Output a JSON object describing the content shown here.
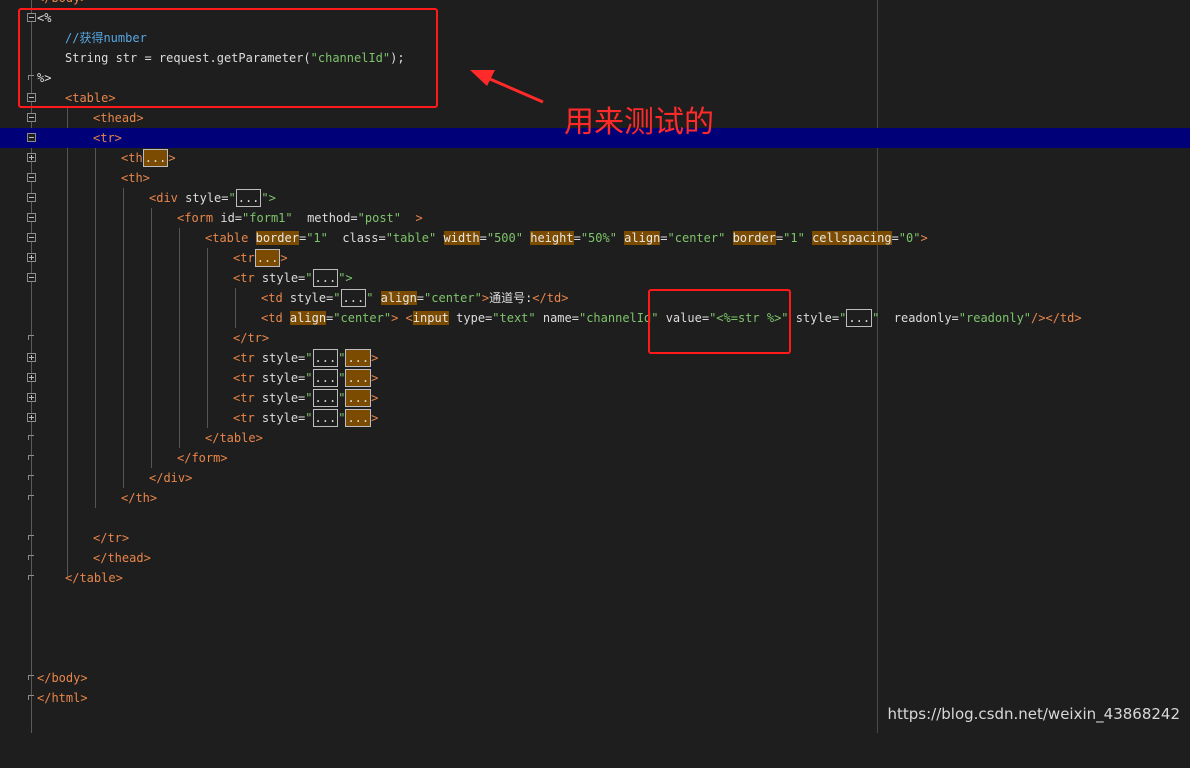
{
  "colors": {
    "background": "#1e1e1e",
    "tag": "#e8864a",
    "attribute_value": "#7ec46b",
    "comment": "#57a6e0",
    "highlight_line": "#000078",
    "annotation": "#ff2a2a"
  },
  "code": {
    "l_body_top": "</body>",
    "jsp_open": "<%",
    "comment": "//获得number",
    "java_stmt_a": "String str = request.getParameter(",
    "java_stmt_b": "\"channelId\"",
    "java_stmt_c": ");",
    "jsp_close": "%>",
    "table_open": "<table>",
    "thead_open": "<thead>",
    "tr_open": "<tr>",
    "th_collapsed_tag": "<th",
    "ellipsis": "...",
    "gt": ">",
    "th_open": "<th>",
    "div_a": "<div",
    "attr_style": "style=",
    "quote": "\"",
    "close_quote_gt": "\">",
    "form_tag": "<form",
    "attr_id": "id=",
    "val_form1": "\"form1\"",
    "attr_method": "method=",
    "val_post": "\"post\"",
    "inner_table": "<table",
    "attr_border": "border",
    "eq": "=",
    "val_1": "\"1\"",
    "attr_class": "class=",
    "val_table": "\"table\"",
    "attr_width": "width",
    "val_500": "\"500\"",
    "attr_height": "height",
    "val_50": "\"50%\"",
    "attr_align": "align",
    "val_center": "\"center\"",
    "attr_cellspacing": "cellspacing",
    "val_0": "\"0\"",
    "tr_collapsed": "<tr",
    "tr_style": "<tr",
    "td_tag": "<td",
    "label_text": "通道号:",
    "td_close": "</td>",
    "input_tag": "input",
    "lt": "<",
    "attr_type": "type=",
    "val_text": "\"text\"",
    "attr_name": "name=",
    "val_channelId": "\"channelId\"",
    "attr_value": "value=",
    "val_expr": "\"<%=str %>\"",
    "attr_readonly": "readonly=",
    "val_readonly": "\"readonly\"",
    "self_close_td": "/></td>",
    "tr_close": "</tr>",
    "table_close": "</table>",
    "form_close": "</form>",
    "div_close": "</div>",
    "th_close": "</th>",
    "thead_close": "</thead>",
    "body_close": "</body>",
    "html_close": "</html>"
  },
  "annotation": {
    "text": "用来测试的"
  },
  "watermark": "https://blog.csdn.net/weixin_43868242"
}
